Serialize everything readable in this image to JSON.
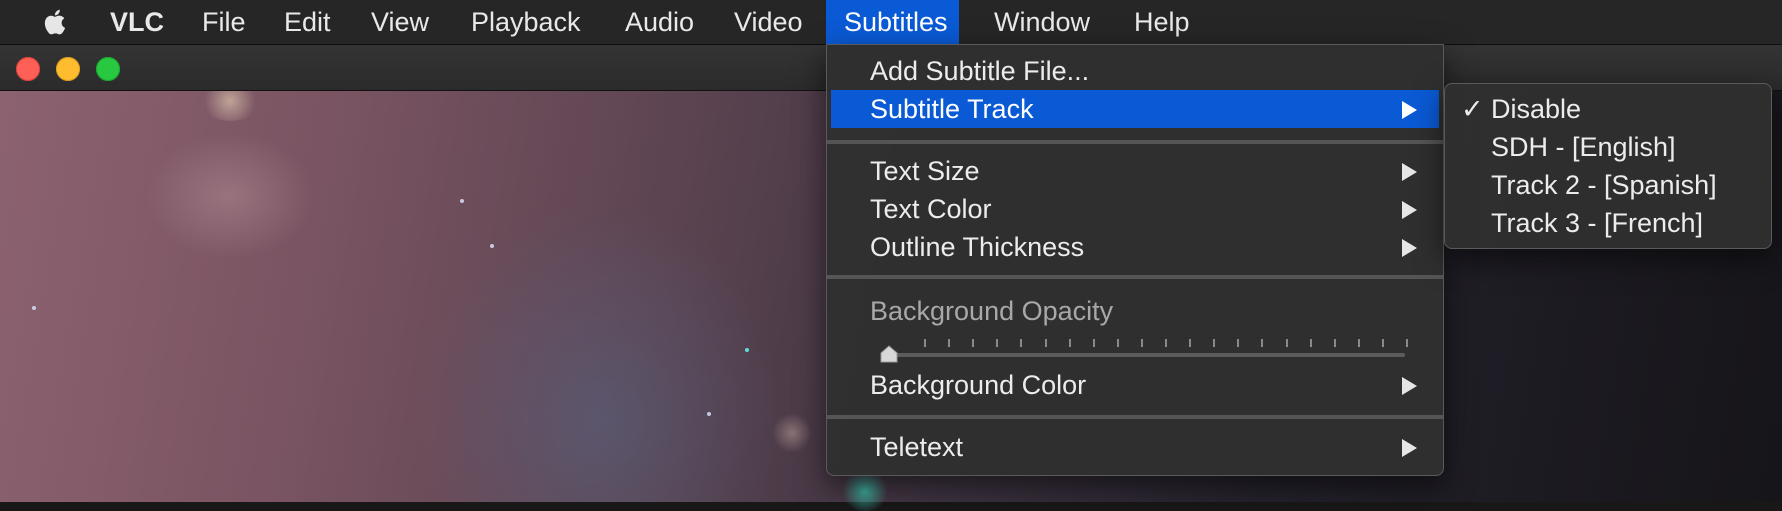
{
  "menubar": {
    "app_name": "VLC",
    "items": [
      "File",
      "Edit",
      "View",
      "Playback",
      "Audio",
      "Video",
      "Subtitles",
      "Window",
      "Help"
    ],
    "active_item": "Subtitles"
  },
  "subtitles_menu": {
    "add_subtitle_file": "Add Subtitle File...",
    "subtitle_track": "Subtitle Track",
    "text_size": "Text Size",
    "text_color": "Text Color",
    "outline_thickness": "Outline Thickness",
    "background_opacity": "Background Opacity",
    "background_opacity_value": 0,
    "background_color": "Background Color",
    "teletext": "Teletext"
  },
  "subtitle_track_menu": {
    "items": [
      "Disable",
      "SDH - [English]",
      "Track 2 - [Spanish]",
      "Track 3 - [French]"
    ],
    "checked": "Disable",
    "check_mark": "✓"
  },
  "colors": {
    "highlight": "#0a5ad5",
    "menu_bg": "#303030",
    "menubar_bg": "#262626"
  },
  "icons": [
    "apple-icon",
    "submenu-arrow-icon",
    "checkmark-icon",
    "slider-knob-icon"
  ]
}
